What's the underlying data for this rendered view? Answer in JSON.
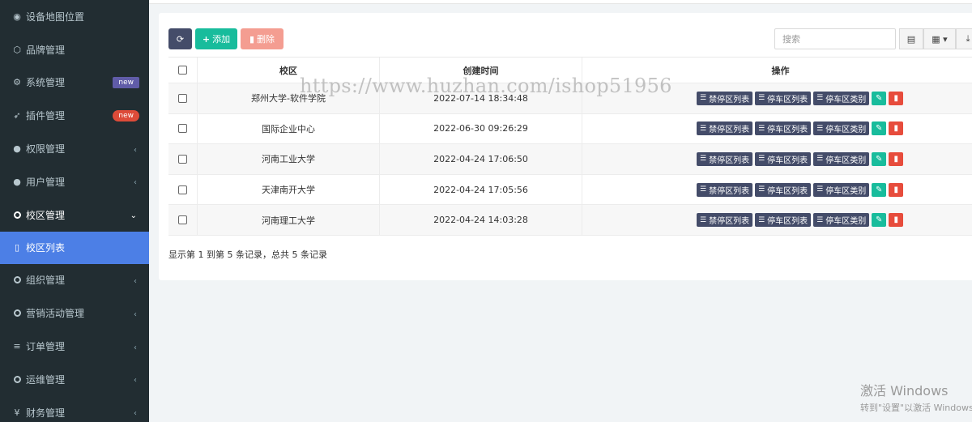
{
  "sidebar": {
    "items": [
      {
        "label": "设备地图位置",
        "icon": "target-icon"
      },
      {
        "label": "品牌管理",
        "icon": "tag-icon"
      },
      {
        "label": "系统管理",
        "icon": "cogs-icon",
        "badge": "new"
      },
      {
        "label": "插件管理",
        "icon": "rocket-icon",
        "badge": "new"
      },
      {
        "label": "权限管理",
        "icon": "group-icon"
      },
      {
        "label": "用户管理",
        "icon": "user-icon"
      },
      {
        "label": "校区管理",
        "icon": "circle-icon"
      },
      {
        "label": "校区列表",
        "icon": "map-icon"
      },
      {
        "label": "组织管理",
        "icon": "circle-icon"
      },
      {
        "label": "营销活动管理",
        "icon": "circle-icon"
      },
      {
        "label": "订单管理",
        "icon": "list-icon"
      },
      {
        "label": "运维管理",
        "icon": "circle-icon"
      },
      {
        "label": "财务管理",
        "icon": "yen-icon"
      }
    ]
  },
  "toolbar": {
    "add_label": "添加",
    "delete_label": "删除",
    "search_placeholder": "搜索"
  },
  "table": {
    "headers": {
      "campus": "校区",
      "created": "创建时间",
      "ops": "操作"
    },
    "rows": [
      {
        "campus": "郑州大学-软件学院",
        "created": "2022-07-14 18:34:48"
      },
      {
        "campus": "国际企业中心",
        "created": "2022-06-30 09:26:29"
      },
      {
        "campus": "河南工业大学",
        "created": "2022-04-24 17:06:50"
      },
      {
        "campus": "天津南开大学",
        "created": "2022-04-24 17:05:56"
      },
      {
        "campus": "河南理工大学",
        "created": "2022-04-24 14:03:28"
      }
    ],
    "op_labels": {
      "no_parking": "禁停区列表",
      "parking": "停车区列表",
      "parking_type": "停车区类别"
    }
  },
  "pagination_info": "显示第 1 到第 5 条记录，总共 5 条记录",
  "watermark": "https://www.huzhan.com/ishop51956",
  "windows_activation": {
    "line1": "激活 Windows",
    "line2": "转到\"设置\"以激活 Windows。"
  },
  "colors": {
    "sidebar_bg": "#222d32",
    "active_item": "#4c7fe6",
    "primary_dark": "#444c69",
    "success": "#18bc9c",
    "danger": "#e74c3c"
  }
}
